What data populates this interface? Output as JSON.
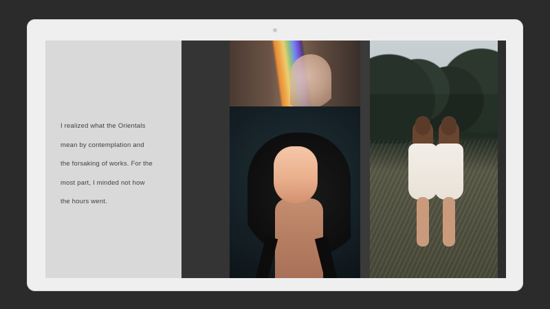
{
  "slide": {
    "quote_lines": [
      "I realized what the Orientals",
      "mean by contemplation and",
      "the forsaking of works. For the",
      "most part, I minded not how",
      "the hours went."
    ]
  },
  "images": [
    {
      "name": "hand-rainbow-photo",
      "subject": "hand with rainbow light"
    },
    {
      "name": "woman-face-photo",
      "subject": "woman with eyes closed"
    },
    {
      "name": "two-girls-field-photo",
      "subject": "two girls in white dresses in a field"
    }
  ],
  "colors": {
    "background": "#2b2b2b",
    "device": "#efefef",
    "text_panel": "#d9d9d9",
    "text": "#3f3f3f"
  }
}
